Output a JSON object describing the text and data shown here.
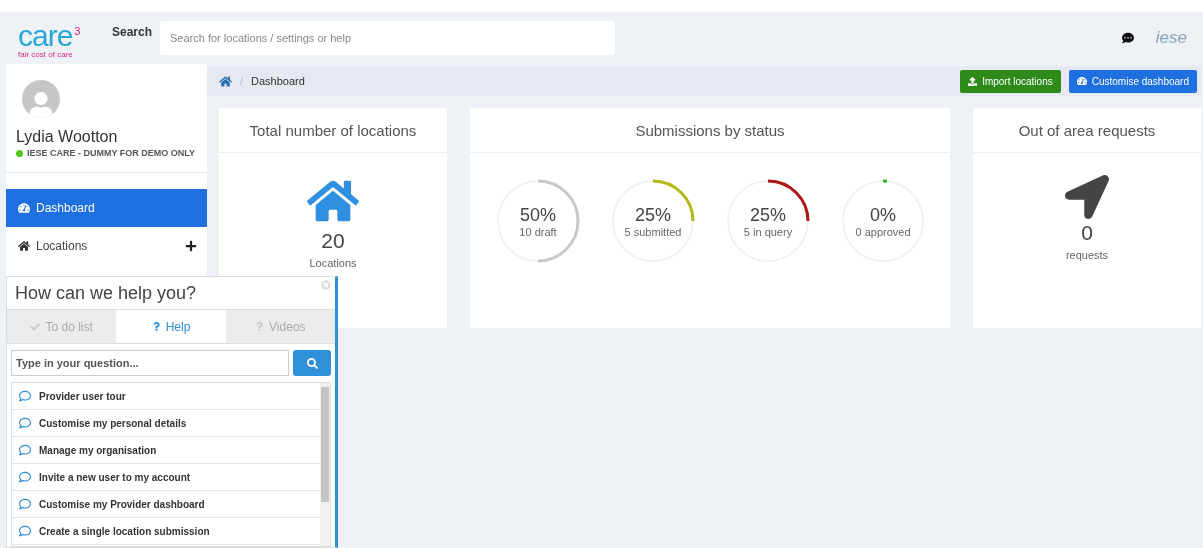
{
  "logo": {
    "word": "care",
    "superscript": "3",
    "tagline": "fair cost of care"
  },
  "search": {
    "label": "Search",
    "placeholder": "Search for locations / settings or help"
  },
  "brand": "iese",
  "user": {
    "name": "Lydia Wootton",
    "organisation": "IESE CARE - DUMMY FOR DEMO ONLY",
    "online": true
  },
  "nav": [
    {
      "label": "Dashboard",
      "kind": "gauge",
      "selected": true,
      "expandable": false
    },
    {
      "label": "Locations",
      "kind": "home",
      "selected": false,
      "expandable": true
    }
  ],
  "breadcrumb": {
    "separator": "/",
    "items": [
      "Dashboard"
    ]
  },
  "actions": [
    {
      "label": "Import locations",
      "kind": "import"
    },
    {
      "label": "Customise dashboard",
      "kind": "customise"
    }
  ],
  "cards": [
    {
      "title": "Total number of locations",
      "kind": "home",
      "value": "20",
      "caption": "Locations"
    },
    {
      "title": "Submissions by status",
      "kind": "donuts",
      "donuts": [
        {
          "percent": "50%",
          "caption": "10 draft",
          "level": 0.5,
          "color": "#c8c8c8"
        },
        {
          "percent": "25%",
          "caption": "5 submitted",
          "level": 0.25,
          "color": "#b5b60f"
        },
        {
          "percent": "25%",
          "caption": "5 in query",
          "level": 0.25,
          "color": "#b01515"
        },
        {
          "percent": "0%",
          "caption": "0 approved",
          "level": 0,
          "color": "#22c022"
        }
      ]
    },
    {
      "title": "Out of area requests",
      "kind": "arrow",
      "value": "0",
      "caption": "requests"
    }
  ],
  "help": {
    "title": "How can we help you?",
    "tabs": [
      {
        "label": "To do list",
        "kind": "check",
        "selected": false
      },
      {
        "label": "Help",
        "kind": "question",
        "selected": true
      },
      {
        "label": "Videos",
        "kind": "question",
        "selected": false
      }
    ],
    "question": {
      "placeholder": "Type in your question..."
    },
    "items": [
      "Provider user tour",
      "Customise my personal details",
      "Manage my organisation",
      "Invite a new user to my account",
      "Customise my Provider dashboard",
      "Create a single location submission"
    ]
  }
}
